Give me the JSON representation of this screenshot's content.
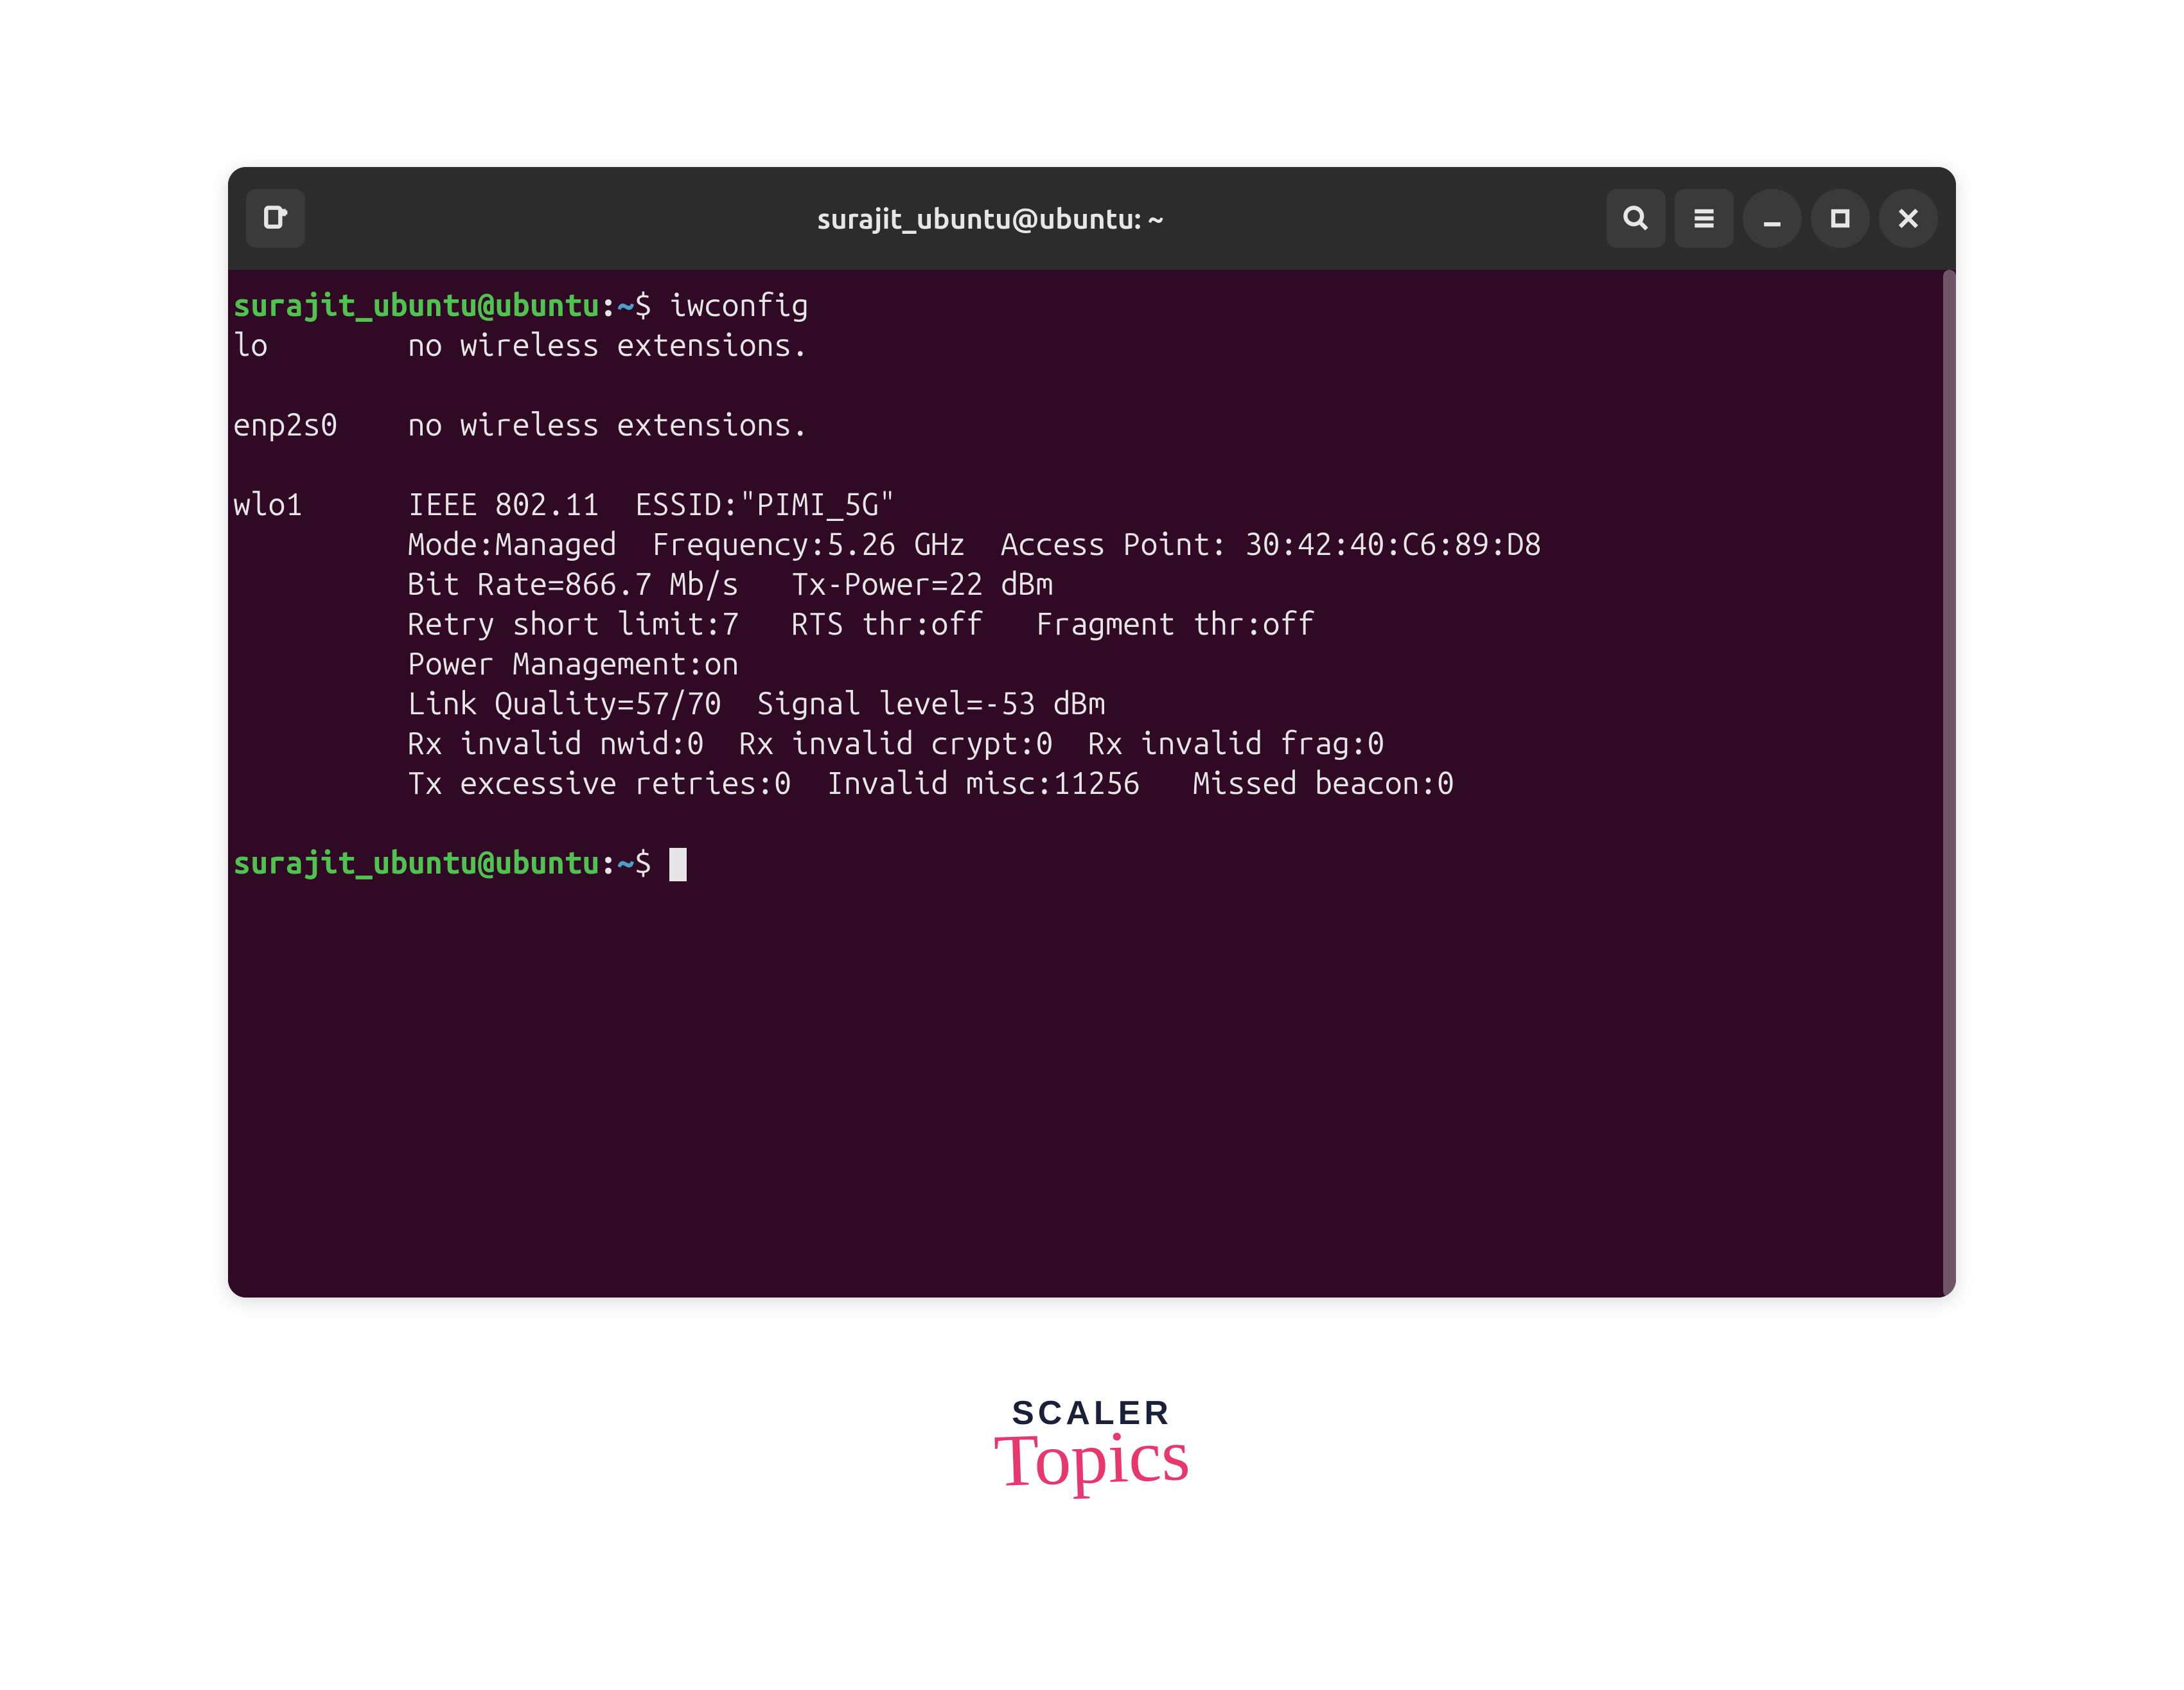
{
  "titlebar": {
    "title": "surajit_ubuntu@ubuntu: ~"
  },
  "prompt": {
    "user_host": "surajit_ubuntu@ubuntu",
    "colon": ":",
    "path": "~",
    "dollar": "$"
  },
  "command": "iwconfig",
  "interfaces": [
    {
      "name": "lo",
      "lines": [
        "no wireless extensions."
      ]
    },
    {
      "name": "enp2s0",
      "lines": [
        "no wireless extensions."
      ]
    },
    {
      "name": "wlo1",
      "lines": [
        "IEEE 802.11  ESSID:\"PIMI_5G\"",
        "Mode:Managed  Frequency:5.26 GHz  Access Point: 30:42:40:C6:89:D8",
        "Bit Rate=866.7 Mb/s   Tx-Power=22 dBm",
        "Retry short limit:7   RTS thr:off   Fragment thr:off",
        "Power Management:on",
        "Link Quality=57/70  Signal level=-53 dBm",
        "Rx invalid nwid:0  Rx invalid crypt:0  Rx invalid frag:0",
        "Tx excessive retries:0  Invalid misc:11256   Missed beacon:0"
      ]
    }
  ],
  "logo": {
    "line1": "SCALER",
    "line2": "Topics"
  },
  "colors": {
    "terminal_bg": "#300a24",
    "titlebar_bg": "#2c2c2c",
    "prompt_user": "#4fc24f",
    "prompt_path": "#4aa0c8",
    "text": "#e6e6e6",
    "logo_scaler": "#1a1f3a",
    "logo_topics": "#e7376c"
  }
}
